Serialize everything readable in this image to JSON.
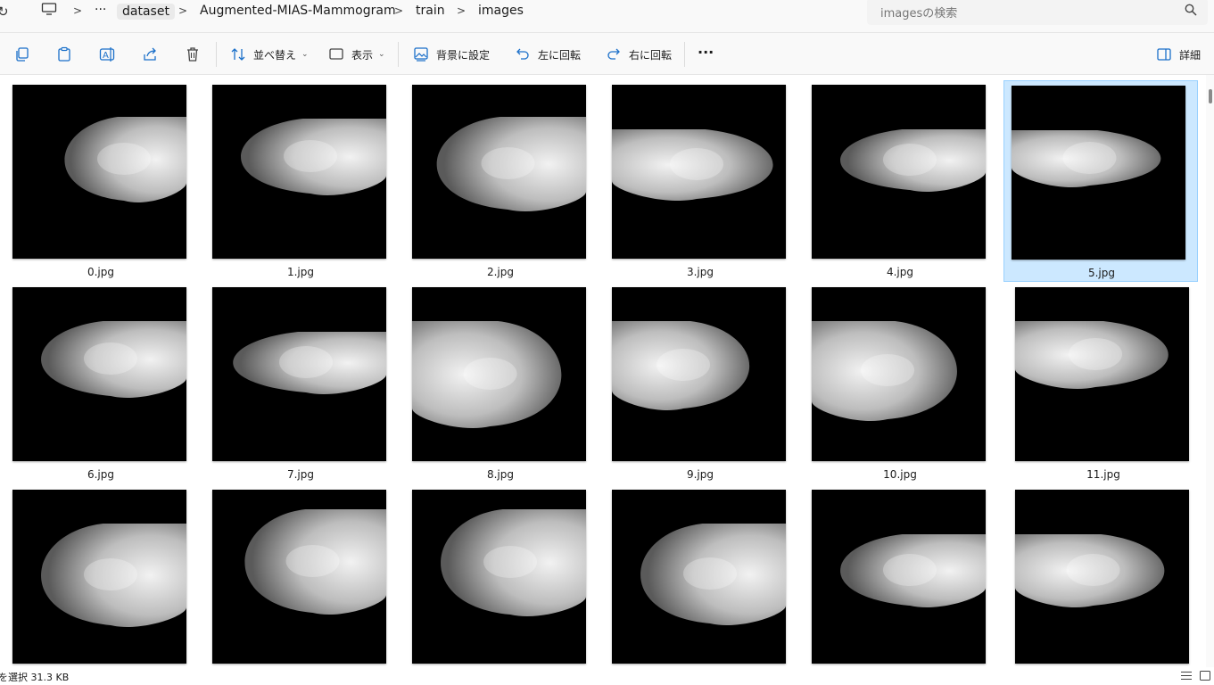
{
  "address": {
    "refresh_icon": "refresh-icon",
    "ellipsis": "···",
    "crumbs": [
      "dataset",
      "Augmented-MIAS-Mammogram",
      "train",
      "images"
    ]
  },
  "search": {
    "placeholder": "imagesの検索"
  },
  "toolbar": {
    "sort_label": "並べ替え",
    "view_label": "表示",
    "set_background_label": "背景に設定",
    "rotate_left_label": "左に回転",
    "rotate_right_label": "右に回転",
    "more_label": "···",
    "details_label": "詳細"
  },
  "files": [
    {
      "name": "0.jpg"
    },
    {
      "name": "1.jpg"
    },
    {
      "name": "2.jpg"
    },
    {
      "name": "3.jpg"
    },
    {
      "name": "4.jpg"
    },
    {
      "name": "5.jpg",
      "selected": true
    },
    {
      "name": "6.jpg"
    },
    {
      "name": "7.jpg"
    },
    {
      "name": "8.jpg"
    },
    {
      "name": "9.jpg"
    },
    {
      "name": "10.jpg"
    },
    {
      "name": "11.jpg"
    },
    {
      "name": ""
    },
    {
      "name": ""
    },
    {
      "name": ""
    },
    {
      "name": ""
    },
    {
      "name": ""
    },
    {
      "name": ""
    }
  ],
  "status": {
    "text": "を選択  31.3 KB"
  },
  "colors": {
    "selection_bg": "#cce8ff",
    "selection_border": "#99d1ff"
  }
}
